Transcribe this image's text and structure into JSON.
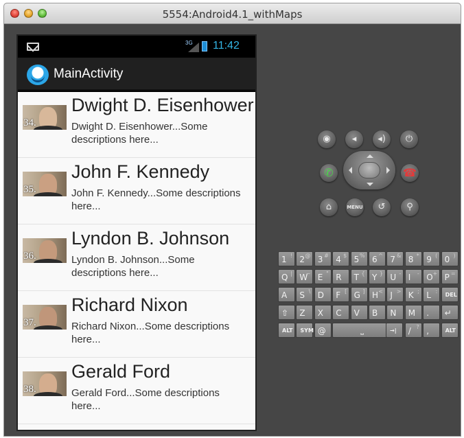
{
  "window": {
    "title": "5554:Android4.1_withMaps"
  },
  "statusbar": {
    "network": "3G",
    "time": "11:42"
  },
  "actionbar": {
    "title": "MainActivity"
  },
  "presidents": [
    {
      "number": "34.",
      "name": "Dwight D. Eisenhower",
      "description": "Dwight D. Eisenhower...Some descriptions here...",
      "face_color": "#d8b89a"
    },
    {
      "number": "35.",
      "name": "John F. Kennedy",
      "description": "John F. Kennedy...Some descriptions here...",
      "face_color": "#caa082"
    },
    {
      "number": "36.",
      "name": "Lyndon B. Johnson",
      "description": "Lyndon B. Johnson...Some descriptions here...",
      "face_color": "#c49a7c"
    },
    {
      "number": "37.",
      "name": "Richard Nixon",
      "description": "Richard Nixon...Some descriptions here...",
      "face_color": "#c0967a"
    },
    {
      "number": "38.",
      "name": "Gerald Ford",
      "description": "Gerald Ford...Some descriptions here...",
      "face_color": "#d4ad8e"
    }
  ],
  "controls": {
    "camera_icon": "camera-icon",
    "volume_down_icon": "volume-down-icon",
    "volume_up_icon": "volume-up-icon",
    "power_icon": "power-icon",
    "menu_label": "MENU"
  },
  "keyboard": {
    "row1": [
      {
        "k": "1",
        "s": "!"
      },
      {
        "k": "2",
        "s": "@"
      },
      {
        "k": "3",
        "s": "#"
      },
      {
        "k": "4",
        "s": "$"
      },
      {
        "k": "5",
        "s": "%"
      },
      {
        "k": "6",
        "s": "^"
      },
      {
        "k": "7",
        "s": "&"
      },
      {
        "k": "8",
        "s": "*"
      },
      {
        "k": "9",
        "s": "("
      },
      {
        "k": "0",
        "s": ")"
      }
    ],
    "row2": [
      {
        "k": "Q",
        "s": "|"
      },
      {
        "k": "W",
        "s": "~"
      },
      {
        "k": "E",
        "s": "\""
      },
      {
        "k": "R",
        "s": ""
      },
      {
        "k": "T",
        "s": "{"
      },
      {
        "k": "Y",
        "s": "}"
      },
      {
        "k": "U",
        "s": "-"
      },
      {
        "k": "I",
        "s": "-"
      },
      {
        "k": "O",
        "s": "+"
      },
      {
        "k": "P",
        "s": "="
      }
    ],
    "row3": [
      {
        "k": "A",
        "s": ""
      },
      {
        "k": "S",
        "s": "\\"
      },
      {
        "k": "D",
        "s": ""
      },
      {
        "k": "F",
        "s": "["
      },
      {
        "k": "G",
        "s": "]"
      },
      {
        "k": "H",
        "s": "<"
      },
      {
        "k": "J",
        "s": ">"
      },
      {
        "k": "K",
        "s": ";"
      },
      {
        "k": "L",
        "s": ":"
      },
      {
        "k": "DEL",
        "s": ""
      }
    ],
    "row4": [
      {
        "k": "⇧",
        "s": ""
      },
      {
        "k": "Z",
        "s": ""
      },
      {
        "k": "X",
        "s": ""
      },
      {
        "k": "C",
        "s": ""
      },
      {
        "k": "V",
        "s": ""
      },
      {
        "k": "B",
        "s": ""
      },
      {
        "k": "N",
        "s": ""
      },
      {
        "k": "M",
        "s": ""
      },
      {
        "k": ".",
        "s": ""
      },
      {
        "k": "↵",
        "s": ""
      }
    ],
    "row5": {
      "alt_left": "ALT",
      "sym": "SYM",
      "at": "@",
      "space": "⎵",
      "tab": "→|",
      "slash": "/",
      "slash_alt": "?",
      "comma": ",",
      "alt_right": "ALT"
    }
  }
}
